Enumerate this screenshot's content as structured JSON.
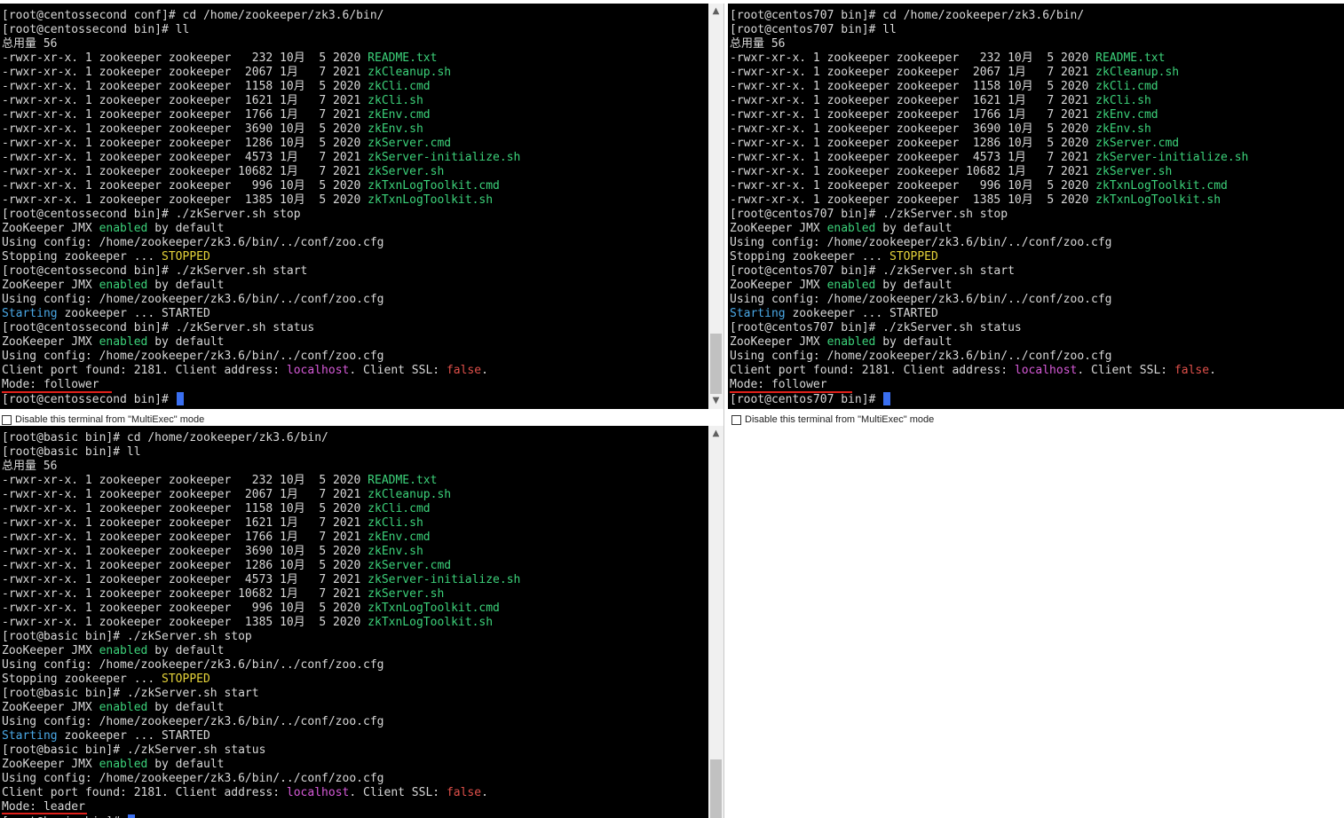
{
  "terminals": [
    {
      "id": "centossecond",
      "lines": [
        [
          {
            "t": "[root@centossecond conf]# cd /home/zookeeper/zk3.6/bin/"
          }
        ],
        [
          {
            "t": "[root@centossecond bin]# ll"
          }
        ],
        [
          {
            "t": "总用量 56"
          }
        ],
        [
          {
            "t": "-rwxr-xr-x. 1 zookeeper zookeeper   232 10月  5 2020 "
          },
          {
            "t": "README.txt",
            "c": "g"
          }
        ],
        [
          {
            "t": "-rwxr-xr-x. 1 zookeeper zookeeper  2067 1月   7 2021 "
          },
          {
            "t": "zkCleanup.sh",
            "c": "g"
          }
        ],
        [
          {
            "t": "-rwxr-xr-x. 1 zookeeper zookeeper  1158 10月  5 2020 "
          },
          {
            "t": "zkCli.cmd",
            "c": "g"
          }
        ],
        [
          {
            "t": "-rwxr-xr-x. 1 zookeeper zookeeper  1621 1月   7 2021 "
          },
          {
            "t": "zkCli.sh",
            "c": "g"
          }
        ],
        [
          {
            "t": "-rwxr-xr-x. 1 zookeeper zookeeper  1766 1月   7 2021 "
          },
          {
            "t": "zkEnv.cmd",
            "c": "g"
          }
        ],
        [
          {
            "t": "-rwxr-xr-x. 1 zookeeper zookeeper  3690 10月  5 2020 "
          },
          {
            "t": "zkEnv.sh",
            "c": "g"
          }
        ],
        [
          {
            "t": "-rwxr-xr-x. 1 zookeeper zookeeper  1286 10月  5 2020 "
          },
          {
            "t": "zkServer.cmd",
            "c": "g"
          }
        ],
        [
          {
            "t": "-rwxr-xr-x. 1 zookeeper zookeeper  4573 1月   7 2021 "
          },
          {
            "t": "zkServer-initialize.sh",
            "c": "g"
          }
        ],
        [
          {
            "t": "-rwxr-xr-x. 1 zookeeper zookeeper 10682 1月   7 2021 "
          },
          {
            "t": "zkServer.sh",
            "c": "g"
          }
        ],
        [
          {
            "t": "-rwxr-xr-x. 1 zookeeper zookeeper   996 10月  5 2020 "
          },
          {
            "t": "zkTxnLogToolkit.cmd",
            "c": "g"
          }
        ],
        [
          {
            "t": "-rwxr-xr-x. 1 zookeeper zookeeper  1385 10月  5 2020 "
          },
          {
            "t": "zkTxnLogToolkit.sh",
            "c": "g"
          }
        ],
        [
          {
            "t": "[root@centossecond bin]# ./zkServer.sh stop"
          }
        ],
        [
          {
            "t": "ZooKeeper JMX "
          },
          {
            "t": "enabled",
            "c": "g"
          },
          {
            "t": " by default"
          }
        ],
        [
          {
            "t": "Using config: /home/zookeeper/zk3.6/bin/../conf/zoo.cfg"
          }
        ],
        [
          {
            "t": "Stopping zookeeper ... "
          },
          {
            "t": "STOPPED",
            "c": "y"
          }
        ],
        [
          {
            "t": "[root@centossecond bin]# ./zkServer.sh start"
          }
        ],
        [
          {
            "t": "ZooKeeper JMX "
          },
          {
            "t": "enabled",
            "c": "g"
          },
          {
            "t": " by default"
          }
        ],
        [
          {
            "t": "Using config: /home/zookeeper/zk3.6/bin/../conf/zoo.cfg"
          }
        ],
        [
          {
            "t": "Starting",
            "c": "b"
          },
          {
            "t": " zookeeper ... STARTED"
          }
        ],
        [
          {
            "t": "[root@centossecond bin]# ./zkServer.sh status"
          }
        ],
        [
          {
            "t": "ZooKeeper JMX "
          },
          {
            "t": "enabled",
            "c": "g"
          },
          {
            "t": " by default"
          }
        ],
        [
          {
            "t": "Using config: /home/zookeeper/zk3.6/bin/../conf/zoo.cfg"
          }
        ],
        [
          {
            "t": "Client port found: 2181. Client address: "
          },
          {
            "t": "localhost",
            "c": "m"
          },
          {
            "t": ". Client SSL: "
          },
          {
            "t": "false",
            "c": "r"
          },
          {
            "t": "."
          }
        ],
        [
          {
            "t": "Mode: follower"
          }
        ],
        [
          {
            "t": "[root@centossecond bin]# "
          }
        ]
      ],
      "multiexec_label": "Disable this terminal from \"MultiExec\" mode"
    },
    {
      "id": "centos707",
      "lines": [
        [
          {
            "t": "[root@centos707 bin]# cd /home/zookeeper/zk3.6/bin/"
          }
        ],
        [
          {
            "t": "[root@centos707 bin]# ll"
          }
        ],
        [
          {
            "t": "总用量 56"
          }
        ],
        [
          {
            "t": "-rwxr-xr-x. 1 zookeeper zookeeper   232 10月  5 2020 "
          },
          {
            "t": "README.txt",
            "c": "g"
          }
        ],
        [
          {
            "t": "-rwxr-xr-x. 1 zookeeper zookeeper  2067 1月   7 2021 "
          },
          {
            "t": "zkCleanup.sh",
            "c": "g"
          }
        ],
        [
          {
            "t": "-rwxr-xr-x. 1 zookeeper zookeeper  1158 10月  5 2020 "
          },
          {
            "t": "zkCli.cmd",
            "c": "g"
          }
        ],
        [
          {
            "t": "-rwxr-xr-x. 1 zookeeper zookeeper  1621 1月   7 2021 "
          },
          {
            "t": "zkCli.sh",
            "c": "g"
          }
        ],
        [
          {
            "t": "-rwxr-xr-x. 1 zookeeper zookeeper  1766 1月   7 2021 "
          },
          {
            "t": "zkEnv.cmd",
            "c": "g"
          }
        ],
        [
          {
            "t": "-rwxr-xr-x. 1 zookeeper zookeeper  3690 10月  5 2020 "
          },
          {
            "t": "zkEnv.sh",
            "c": "g"
          }
        ],
        [
          {
            "t": "-rwxr-xr-x. 1 zookeeper zookeeper  1286 10月  5 2020 "
          },
          {
            "t": "zkServer.cmd",
            "c": "g"
          }
        ],
        [
          {
            "t": "-rwxr-xr-x. 1 zookeeper zookeeper  4573 1月   7 2021 "
          },
          {
            "t": "zkServer-initialize.sh",
            "c": "g"
          }
        ],
        [
          {
            "t": "-rwxr-xr-x. 1 zookeeper zookeeper 10682 1月   7 2021 "
          },
          {
            "t": "zkServer.sh",
            "c": "g"
          }
        ],
        [
          {
            "t": "-rwxr-xr-x. 1 zookeeper zookeeper   996 10月  5 2020 "
          },
          {
            "t": "zkTxnLogToolkit.cmd",
            "c": "g"
          }
        ],
        [
          {
            "t": "-rwxr-xr-x. 1 zookeeper zookeeper  1385 10月  5 2020 "
          },
          {
            "t": "zkTxnLogToolkit.sh",
            "c": "g"
          }
        ],
        [
          {
            "t": "[root@centos707 bin]# ./zkServer.sh stop"
          }
        ],
        [
          {
            "t": "ZooKeeper JMX "
          },
          {
            "t": "enabled",
            "c": "g"
          },
          {
            "t": " by default"
          }
        ],
        [
          {
            "t": "Using config: /home/zookeeper/zk3.6/bin/../conf/zoo.cfg"
          }
        ],
        [
          {
            "t": "Stopping zookeeper ... "
          },
          {
            "t": "STOPPED",
            "c": "y"
          }
        ],
        [
          {
            "t": "[root@centos707 bin]# ./zkServer.sh start"
          }
        ],
        [
          {
            "t": "ZooKeeper JMX "
          },
          {
            "t": "enabled",
            "c": "g"
          },
          {
            "t": " by default"
          }
        ],
        [
          {
            "t": "Using config: /home/zookeeper/zk3.6/bin/../conf/zoo.cfg"
          }
        ],
        [
          {
            "t": "Starting",
            "c": "b"
          },
          {
            "t": " zookeeper ... STARTED"
          }
        ],
        [
          {
            "t": "[root@centos707 bin]# ./zkServer.sh status"
          }
        ],
        [
          {
            "t": "ZooKeeper JMX "
          },
          {
            "t": "enabled",
            "c": "g"
          },
          {
            "t": " by default"
          }
        ],
        [
          {
            "t": "Using config: /home/zookeeper/zk3.6/bin/../conf/zoo.cfg"
          }
        ],
        [
          {
            "t": "Client port found: 2181. Client address: "
          },
          {
            "t": "localhost",
            "c": "m"
          },
          {
            "t": ". Client SSL: "
          },
          {
            "t": "false",
            "c": "r"
          },
          {
            "t": "."
          }
        ],
        [
          {
            "t": "Mode: follower"
          }
        ],
        [
          {
            "t": "[root@centos707 bin]# "
          }
        ]
      ],
      "multiexec_label": "Disable this terminal from \"MultiExec\" mode"
    },
    {
      "id": "basic",
      "lines": [
        [
          {
            "t": "[root@basic bin]# cd /home/zookeeper/zk3.6/bin/"
          }
        ],
        [
          {
            "t": "[root@basic bin]# ll"
          }
        ],
        [
          {
            "t": "总用量 56"
          }
        ],
        [
          {
            "t": "-rwxr-xr-x. 1 zookeeper zookeeper   232 10月  5 2020 "
          },
          {
            "t": "README.txt",
            "c": "g"
          }
        ],
        [
          {
            "t": "-rwxr-xr-x. 1 zookeeper zookeeper  2067 1月   7 2021 "
          },
          {
            "t": "zkCleanup.sh",
            "c": "g"
          }
        ],
        [
          {
            "t": "-rwxr-xr-x. 1 zookeeper zookeeper  1158 10月  5 2020 "
          },
          {
            "t": "zkCli.cmd",
            "c": "g"
          }
        ],
        [
          {
            "t": "-rwxr-xr-x. 1 zookeeper zookeeper  1621 1月   7 2021 "
          },
          {
            "t": "zkCli.sh",
            "c": "g"
          }
        ],
        [
          {
            "t": "-rwxr-xr-x. 1 zookeeper zookeeper  1766 1月   7 2021 "
          },
          {
            "t": "zkEnv.cmd",
            "c": "g"
          }
        ],
        [
          {
            "t": "-rwxr-xr-x. 1 zookeeper zookeeper  3690 10月  5 2020 "
          },
          {
            "t": "zkEnv.sh",
            "c": "g"
          }
        ],
        [
          {
            "t": "-rwxr-xr-x. 1 zookeeper zookeeper  1286 10月  5 2020 "
          },
          {
            "t": "zkServer.cmd",
            "c": "g"
          }
        ],
        [
          {
            "t": "-rwxr-xr-x. 1 zookeeper zookeeper  4573 1月   7 2021 "
          },
          {
            "t": "zkServer-initialize.sh",
            "c": "g"
          }
        ],
        [
          {
            "t": "-rwxr-xr-x. 1 zookeeper zookeeper 10682 1月   7 2021 "
          },
          {
            "t": "zkServer.sh",
            "c": "g"
          }
        ],
        [
          {
            "t": "-rwxr-xr-x. 1 zookeeper zookeeper   996 10月  5 2020 "
          },
          {
            "t": "zkTxnLogToolkit.cmd",
            "c": "g"
          }
        ],
        [
          {
            "t": "-rwxr-xr-x. 1 zookeeper zookeeper  1385 10月  5 2020 "
          },
          {
            "t": "zkTxnLogToolkit.sh",
            "c": "g"
          }
        ],
        [
          {
            "t": "[root@basic bin]# ./zkServer.sh stop"
          }
        ],
        [
          {
            "t": "ZooKeeper JMX "
          },
          {
            "t": "enabled",
            "c": "g"
          },
          {
            "t": " by default"
          }
        ],
        [
          {
            "t": "Using config: /home/zookeeper/zk3.6/bin/../conf/zoo.cfg"
          }
        ],
        [
          {
            "t": "Stopping zookeeper ... "
          },
          {
            "t": "STOPPED",
            "c": "y"
          }
        ],
        [
          {
            "t": "[root@basic bin]# ./zkServer.sh start"
          }
        ],
        [
          {
            "t": "ZooKeeper JMX "
          },
          {
            "t": "enabled",
            "c": "g"
          },
          {
            "t": " by default"
          }
        ],
        [
          {
            "t": "Using config: /home/zookeeper/zk3.6/bin/../conf/zoo.cfg"
          }
        ],
        [
          {
            "t": "Starting",
            "c": "b"
          },
          {
            "t": " zookeeper ... STARTED"
          }
        ],
        [
          {
            "t": "[root@basic bin]# ./zkServer.sh status"
          }
        ],
        [
          {
            "t": "ZooKeeper JMX "
          },
          {
            "t": "enabled",
            "c": "g"
          },
          {
            "t": " by default"
          }
        ],
        [
          {
            "t": "Using config: /home/zookeeper/zk3.6/bin/../conf/zoo.cfg"
          }
        ],
        [
          {
            "t": "Client port found: 2181. Client address: "
          },
          {
            "t": "localhost",
            "c": "m"
          },
          {
            "t": ". Client SSL: "
          },
          {
            "t": "false",
            "c": "r"
          },
          {
            "t": "."
          }
        ],
        [
          {
            "t": "Mode: leader"
          }
        ],
        [
          {
            "t": "[root@basic bin]# "
          }
        ]
      ]
    }
  ],
  "colors": {
    "terminal_bg": "#000000",
    "text": "#d8d8d8",
    "green": "#3cd27a",
    "yellow": "#e5d33a",
    "blue": "#4aa8e6",
    "magenta": "#d65ad8",
    "red": "#e0504a",
    "annotation_underline": "#e0201a",
    "cursor": "#3a6ff0"
  },
  "icons": {
    "scroll_up": "▲",
    "scroll_down": "▼"
  }
}
